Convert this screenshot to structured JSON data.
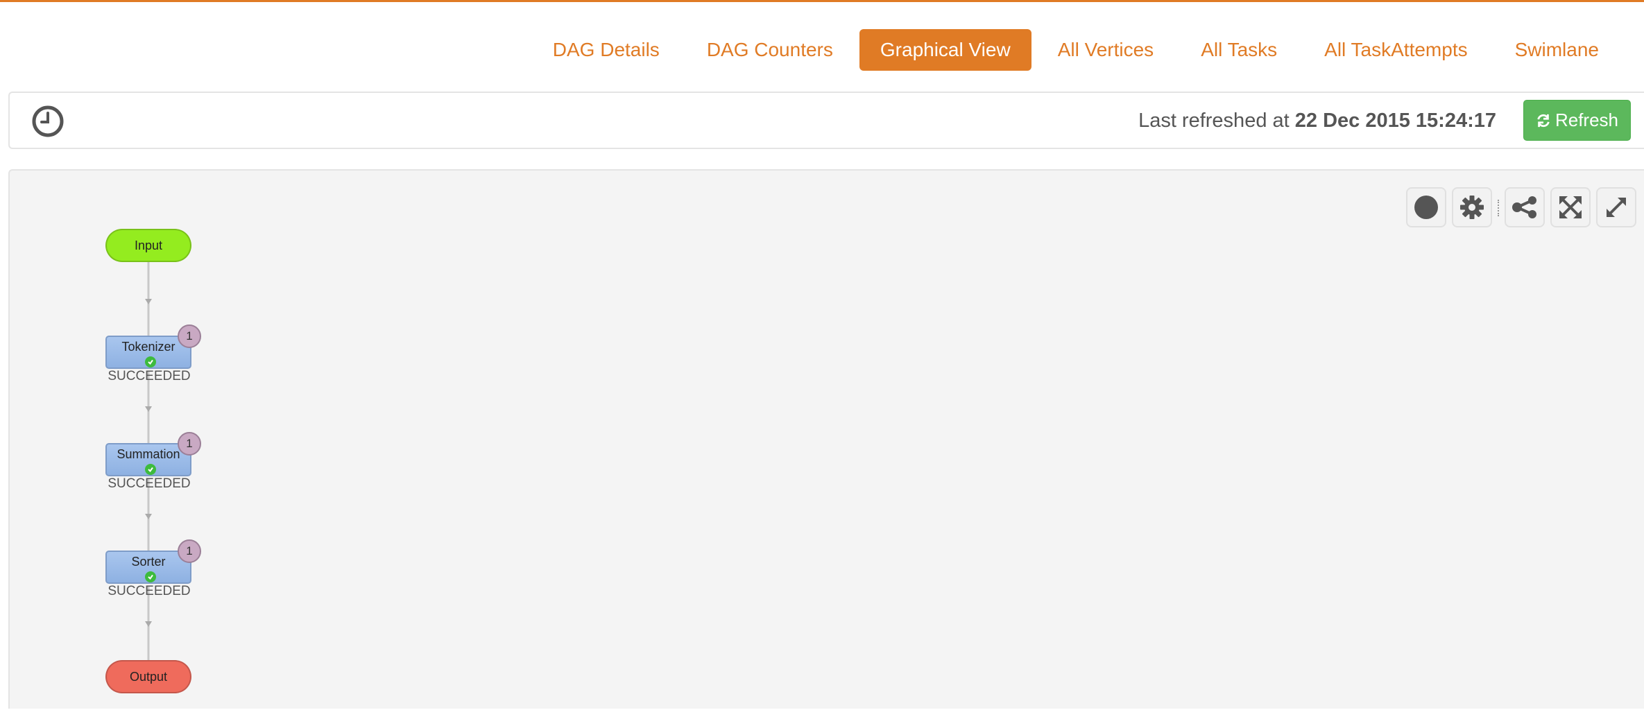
{
  "tabs": [
    {
      "label": "DAG Details",
      "active": false
    },
    {
      "label": "DAG Counters",
      "active": false
    },
    {
      "label": "Graphical View",
      "active": true
    },
    {
      "label": "All Vertices",
      "active": false
    },
    {
      "label": "All Tasks",
      "active": false
    },
    {
      "label": "All TaskAttempts",
      "active": false
    },
    {
      "label": "Swimlane",
      "active": false
    }
  ],
  "refresh": {
    "prefix": "Last refreshed at",
    "timestamp": "22 Dec 2015 15:24:17",
    "button_label": "Refresh",
    "icon": "refresh-icon"
  },
  "toolbar": {
    "icons": [
      "circle-icon",
      "gear-icon",
      "share-icon",
      "fit-icon",
      "fullscreen-icon"
    ]
  },
  "graph": {
    "input": {
      "label": "Input",
      "color": "#94ec1f"
    },
    "output": {
      "label": "Output",
      "color": "#ef6b5c"
    },
    "vertices": [
      {
        "name": "Tokenizer",
        "status": "SUCCEEDED",
        "tasks": "1"
      },
      {
        "name": "Summation",
        "status": "SUCCEEDED",
        "tasks": "1"
      },
      {
        "name": "Sorter",
        "status": "SUCCEEDED",
        "tasks": "1"
      }
    ]
  },
  "colors": {
    "accent": "#e07b25",
    "success": "#5cb85c",
    "vertex": "#a9c6ee"
  }
}
